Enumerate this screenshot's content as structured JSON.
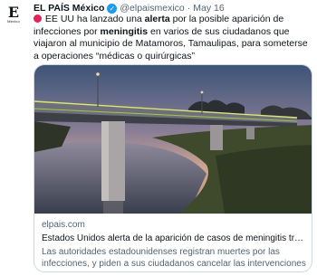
{
  "tweet": {
    "author_name": "EL PAÍS México",
    "handle": "@elpaismexico",
    "separator": "·",
    "date": "May 16",
    "avatar_letter": "E",
    "avatar_label": "Mexico",
    "text_part1": "EE UU ha lanzado una ",
    "text_bold1": "alerta",
    "text_part2": " por la posible aparición de infecciones por ",
    "text_bold2": "meningitis",
    "text_part3": " en varios de sus ciudadanos que viajaron al municipio de Matamoros, Tamaulipas, para someterse a operaciones “médicas o quirúrgicas”"
  },
  "card": {
    "domain": "elpais.com",
    "title": "Estados Unidos alerta de la aparición de casos de meningitis tras va...",
    "description": "Las autoridades estadounidenses registran muertes por las infecciones, y piden a sus ciudadanos cancelar las intervenciones e..."
  },
  "colors": {
    "verified": "#1d9bf0",
    "red_circle": "#e0245e",
    "secondary_text": "#536471",
    "border": "#cfd9de"
  }
}
